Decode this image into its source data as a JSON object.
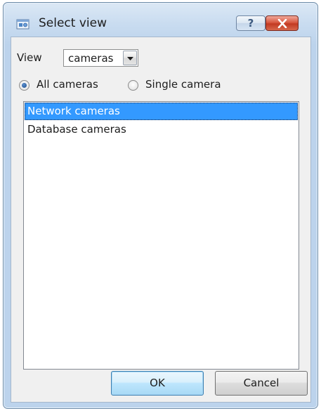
{
  "window": {
    "title": "Select view",
    "help_glyph": "?",
    "icon": "view-icon"
  },
  "view": {
    "label": "View",
    "selected": "cameras"
  },
  "radios": {
    "all_label": "All cameras",
    "single_label": "Single camera",
    "selected": "All cameras"
  },
  "list": {
    "items": [
      "Network cameras",
      "Database cameras"
    ],
    "selected_index": 0
  },
  "buttons": {
    "ok": "OK",
    "cancel": "Cancel"
  },
  "colors": {
    "selection": "#3399ff",
    "close_button": "#c23a22",
    "titlebar": "#c9dcf0"
  }
}
